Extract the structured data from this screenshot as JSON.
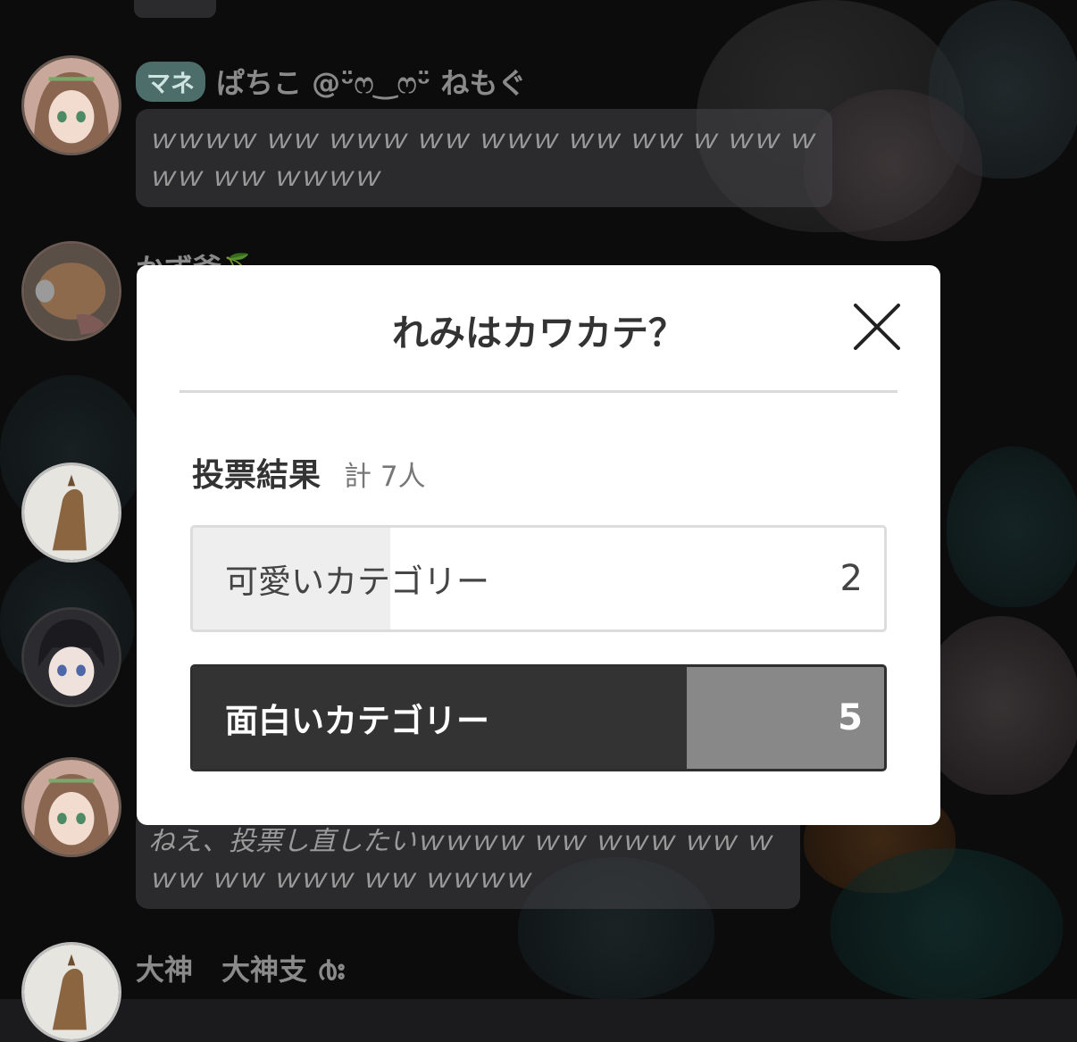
{
  "chat": {
    "messages": [
      {
        "badge": "マネ",
        "name": "ぱちこ @ᵕ̈ෆ‿ෆᵕ̈ ねもぐ",
        "text": "ｗｗｗｗ ｗｗ ｗｗｗ ｗｗ ｗｗｗ ｗｗ ｗｗ ｗ ｗｗ ｗｗｗ ｗｗ ｗｗｗｗ"
      },
      {
        "name": "かず爺🍒"
      },
      {
        "text": "ねえ、投票し直したいｗｗｗｗ ｗｗ ｗｗｗ ｗｗ ｗｗｗ ｗｗ ｗｗｗ ｗｗ ｗｗｗｗ"
      },
      {
        "name": "大神　大神支 ൪ഃ"
      }
    ]
  },
  "modal": {
    "title": "れみはカワカテ？",
    "results_label": "投票結果",
    "total_label": "計 7人",
    "options": [
      {
        "label": "可愛いカテゴリー",
        "count": "2",
        "fraction": 0.286,
        "selected": false
      },
      {
        "label": "面白いカテゴリー",
        "count": "5",
        "fraction": 0.714,
        "selected": true
      }
    ]
  },
  "colors": {
    "selected_fill": "#333333",
    "selected_bar_rest": "#888888",
    "unselected_fill": "#eeeeee",
    "badge": "#4c6d6a"
  },
  "icons": {
    "close": "close-icon"
  }
}
